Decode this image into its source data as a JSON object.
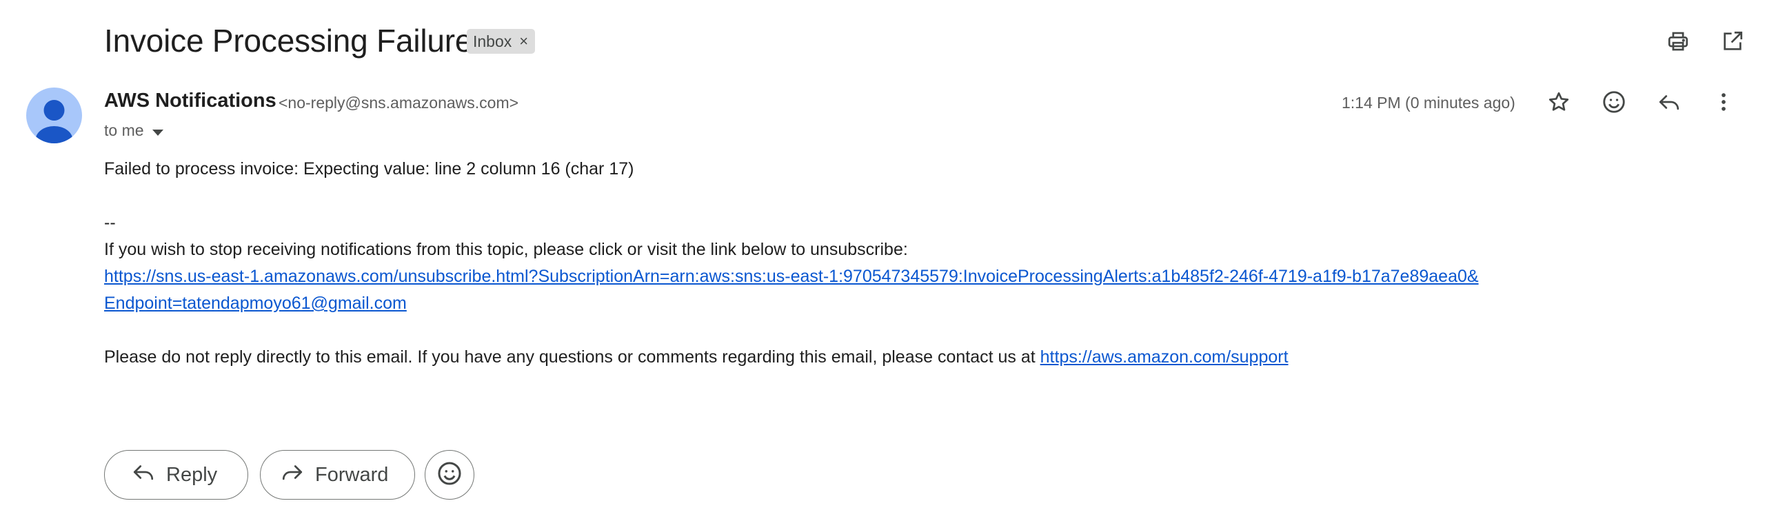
{
  "message": {
    "subject": "Invoice Processing Failure",
    "label": "Inbox",
    "label_remove": "×"
  },
  "sender": {
    "name": "AWS Notifications",
    "email": "<no-reply@sns.amazonaws.com>",
    "recipient": "to me",
    "time": "1:14 PM (0 minutes ago)"
  },
  "body": {
    "line1": "Failed to process invoice: Expecting value: line 2 column 16 (char 17)",
    "separator": "--",
    "line2": "If you wish to stop receiving notifications from this topic, please click or visit the link below to unsubscribe:",
    "link1a": "https://sns.us-east-1.amazonaws.com/unsubscribe.html?SubscriptionArn=arn:aws:sns:us-east-1:970547345579:InvoiceProcessingAlerts:a1b485f2-246f-4719-a1f9-b17a7e89aea0&",
    "link1b": "Endpoint=tatendapmoyo61@gmail.com",
    "line3": "Please do not reply directly to this email. If you have any questions or comments regarding this email, please contact us at ",
    "link2": "https://aws.amazon.com/support"
  },
  "actions": {
    "reply": "Reply",
    "forward": "Forward"
  },
  "icons": {
    "print": "print-icon",
    "open_new_window": "open-in-new-window-icon",
    "star": "star-icon",
    "emoji": "emoji-icon",
    "reply": "reply-icon",
    "more": "more-vert-icon"
  },
  "colors": {
    "link": "#0b57d0",
    "avatar_bg": "#a8c7fa",
    "avatar_fg": "#1a56c6",
    "chip_bg": "#dddddd"
  }
}
